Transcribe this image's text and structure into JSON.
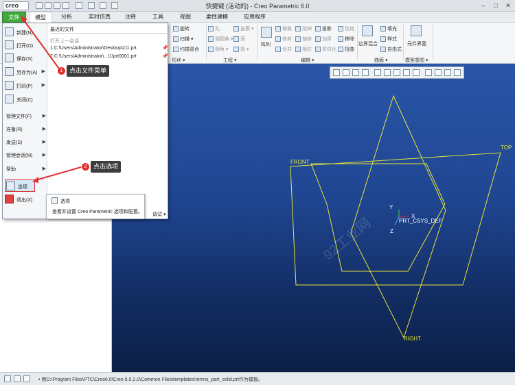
{
  "titlebar": {
    "logo": "creo",
    "window_title": "快捷键 (活动的) - Creo Parametric 6.0"
  },
  "tabs": [
    "文件",
    "模型",
    "分析",
    "实时仿真",
    "注释",
    "工具",
    "视图",
    "柔性建模",
    "应用程序"
  ],
  "ribbon": {
    "shapes": {
      "revolve": "旋转",
      "sweep": "扫描",
      "swept_blend": "扫描混合",
      "group": "形状"
    },
    "engineering": {
      "hole": "孔",
      "round": "倒圆角",
      "chamfer": "倒角",
      "draft": "拔模",
      "shell": "壳",
      "rib": "筋",
      "group": "工程"
    },
    "editing": {
      "pattern": "阵列",
      "mirror": "镜像",
      "extend": "延伸",
      "project": "投影",
      "trim": "修剪",
      "offset": "偏移",
      "thicken": "加厚",
      "merge": "合并",
      "intersect": "相交",
      "solidify": "实体化",
      "wrap": "包络",
      "remove": "移除",
      "emboss": "扭曲",
      "group": "编辑"
    },
    "surfaces": {
      "boundary_blend": "边界混合",
      "fill": "填充",
      "style": "样式",
      "freestyle": "自由式",
      "group": "曲面"
    },
    "model_intent": {
      "component_interface": "元件界面",
      "group": "模型意图"
    }
  },
  "file_menu": {
    "items": [
      {
        "label": "新建(N)",
        "arrow": ""
      },
      {
        "label": "打开(O)",
        "arrow": ""
      },
      {
        "label": "保存(S)",
        "arrow": ""
      },
      {
        "label": "另存为(A)",
        "arrow": "▶"
      },
      {
        "label": "打印(P)",
        "arrow": "▶"
      },
      {
        "label": "关闭(C)",
        "arrow": ""
      }
    ],
    "text_items": [
      {
        "label": "管理文件(F)",
        "arrow": "▶"
      },
      {
        "label": "准备(R)",
        "arrow": "▶"
      },
      {
        "label": "发送(S)",
        "arrow": "▶"
      },
      {
        "label": "管理会话(M)",
        "arrow": "▶"
      },
      {
        "label": "帮助",
        "arrow": "▶"
      }
    ],
    "options": "选项",
    "exit": "退出(X)",
    "recent_header": "最近的文件",
    "recent_files": [
      "打开上一会话",
      "1 C:\\Users\\Administrator\\Desktop\\1\\1.prt",
      "2 C:\\Users\\Administrator\\...\\1\\prt0001.prt"
    ],
    "pin": "📌",
    "debug": "调试 ▾"
  },
  "tooltip": {
    "title": "选项",
    "description": "查看并设置 Creo Parametric 选项和配置。"
  },
  "callouts": [
    {
      "num": "1",
      "text": "点击文件菜单"
    },
    {
      "num": "2",
      "text": "点击选项"
    }
  ],
  "viewport": {
    "datums": {
      "front": "FRONT",
      "top": "TOP",
      "right": "RIGHT",
      "csys": "PRT_CSYS_DEF"
    },
    "axes": {
      "x": "X",
      "y": "Y",
      "z": "Z"
    },
    "watermark": "92工业网"
  },
  "status_bar": {
    "text": "• 用D:\\Program Files\\PTC\\Creo6.0\\Creo 6.0.2.0\\Common Files\\templates\\mmns_part_solid.prt作为模板。"
  },
  "colors": {
    "file_tab": "#43a83b",
    "datum": "#e6e63a",
    "highlight": "#e03030",
    "viewport_top": "#2a56a8",
    "viewport_bottom": "#0c1f46"
  }
}
